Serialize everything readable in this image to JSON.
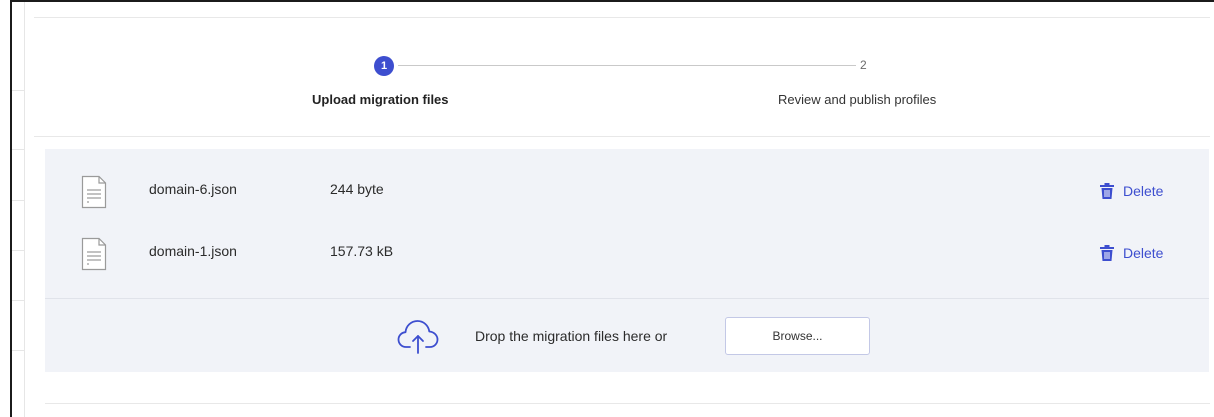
{
  "stepper": {
    "steps": [
      {
        "number": "1",
        "label": "Upload migration files"
      },
      {
        "number": "2",
        "label": "Review and publish profiles"
      }
    ],
    "active_step": 1,
    "accent_color": "#3d4ecf"
  },
  "files": [
    {
      "name": "domain-6.json",
      "size": "244 byte",
      "delete_label": "Delete",
      "icon": "document-icon"
    },
    {
      "name": "domain-1.json",
      "size": "157.73 kB",
      "delete_label": "Delete",
      "icon": "document-icon"
    }
  ],
  "dropzone": {
    "icon": "cloud-upload-icon",
    "text": "Drop the migration files here or",
    "browse_label": "Browse..."
  }
}
